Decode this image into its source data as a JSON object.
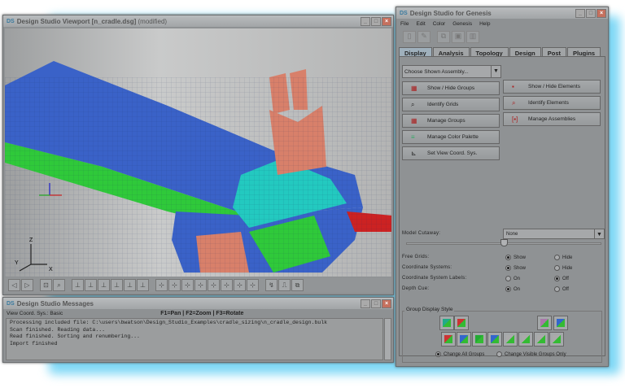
{
  "viewport": {
    "title": "Design Studio Viewport [n_cradle.dsg]",
    "modified": "(modified)",
    "axis_labels": {
      "z": "Z",
      "y": "Y",
      "x": "X"
    },
    "toolbar": [
      "back-icon",
      "forward-icon",
      "fit-view-icon",
      "zoom-window-icon",
      "view-xz-icon",
      "view-xz-neg-icon",
      "view-xy-icon",
      "view-xy-neg-icon",
      "view-yz-icon",
      "view-zy-icon",
      "iso-1-icon",
      "iso-2-icon",
      "iso-3-icon",
      "iso-4-icon",
      "iso-5-icon",
      "iso-6-icon",
      "iso-7-icon",
      "iso-8-icon",
      "pick-icon",
      "mouse-icon",
      "snapshot-icon"
    ]
  },
  "messages": {
    "title": "Design Studio Messages",
    "view_coord": "View Coord. Sys.: Basic",
    "keys": "F1=Pan | F2=Zoom | F3=Rotate",
    "lines": [
      "Processing included file: C:\\users\\bwatson\\Design_Studio_Examples\\cradle_sizing\\n_cradle_design.bulk",
      "Scan finished.  Reading data...",
      "Read finished.  Sorting and renumbering...",
      "Import finished"
    ]
  },
  "genesis": {
    "title": "Design Studio for Genesis",
    "logo": "DS",
    "menu": [
      "File",
      "Edit",
      "Color",
      "Genesis",
      "Help"
    ],
    "tabs": [
      "Display",
      "Analysis",
      "Topology",
      "Design",
      "Post",
      "Plugins"
    ],
    "active_tab": "Display",
    "assembly_combo": "Choose Shown Assembly...",
    "buttons": [
      "Show / Hide Groups",
      "Show / Hide Elements",
      "Identify Grids",
      "Identify Elements",
      "Manage Groups",
      "Manage Assemblies",
      "Manage Color Palette",
      "Set View Coord. Sys."
    ],
    "cutaway_label": "Model Cutaway:",
    "cutaway_value": "None",
    "cutaway_slider": 0.5,
    "options": [
      {
        "label": "Free Grids:",
        "a": "Show",
        "b": "Hide",
        "selected": "a"
      },
      {
        "label": "Coordinate Systems:",
        "a": "Show",
        "b": "Hide",
        "selected": "a"
      },
      {
        "label": "Coordinate System Labels:",
        "a": "On",
        "b": "Off",
        "selected": "b"
      },
      {
        "label": "Depth Cue:",
        "a": "On",
        "b": "Off",
        "selected": "a"
      }
    ],
    "group_style_title": "Group Display Style",
    "change_all": "Change All Groups",
    "change_visible": "Change Visible Groups Only",
    "change_selected": "all"
  }
}
